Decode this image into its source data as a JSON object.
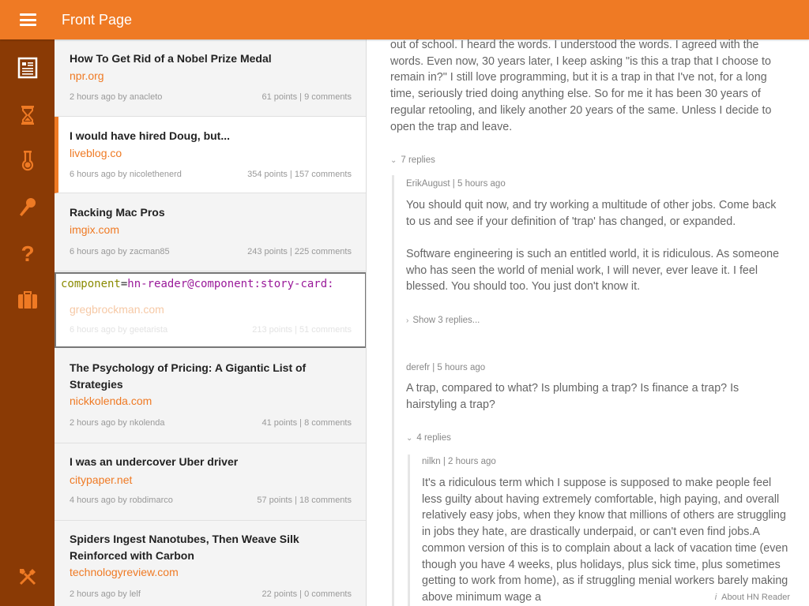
{
  "app": {
    "title": "Front Page",
    "about_label": "About HN Reader"
  },
  "sidebar": {
    "items": [
      {
        "name": "front-page",
        "icon": "newspaper-icon"
      },
      {
        "name": "newest",
        "icon": "hourglass-icon"
      },
      {
        "name": "show",
        "icon": "flask-icon"
      },
      {
        "name": "ask",
        "icon": "microphone-icon"
      },
      {
        "name": "help",
        "icon": "question-icon"
      },
      {
        "name": "jobs",
        "icon": "briefcase-icon"
      }
    ],
    "bottom_icon": "tools-icon"
  },
  "stories": [
    {
      "title": "How To Get Rid of a Nobel Prize Medal",
      "domain": "npr.org",
      "age": "2 hours ago by anacleto",
      "stats": "61 points | 9 comments"
    },
    {
      "title": "I would have hired Doug, but...",
      "domain": "liveblog.co",
      "age": "6 hours ago by nicolethenerd",
      "stats": "354 points | 157 comments"
    },
    {
      "title": "Racking Mac Pros",
      "domain": "imgix.com",
      "age": "6 hours ago by zacman85",
      "stats": "243 points | 225 comments"
    },
    {
      "title": "",
      "domain": "gregbrockman.com",
      "age": "6 hours ago by geetarista",
      "stats": "213 points | 51 comments"
    },
    {
      "title": "The Psychology of Pricing: A Gigantic List of Strategies",
      "domain": "nickkolenda.com",
      "age": "2 hours ago by nkolenda",
      "stats": "41 points | 8 comments"
    },
    {
      "title": "I was an undercover Uber driver",
      "domain": "citypaper.net",
      "age": "4 hours ago by robdimarco",
      "stats": "57 points | 18 comments"
    },
    {
      "title": "Spiders Ingest Nanotubes, Then Weave Silk Reinforced with Carbon",
      "domain": "technologyreview.com",
      "age": "2 hours ago by lelf",
      "stats": "22 points | 0 comments"
    }
  ],
  "debug_overlay": {
    "key": "component",
    "eq": "=",
    "value": "hn-reader@component:story-card:"
  },
  "comments": {
    "top_text": "out of school. I heard the words. I understood the words. I agreed with the words. Even now, 30 years later, I keep asking \"is this a trap that I choose to remain in?\" I still love programming, but it is a trap in that I've not, for a long time, seriously tried doing anything else.  So for me it has been 30 years of regular retooling, and likely another 20 years of the same. Unless I decide to open the trap and leave.",
    "top_replies_label": "7 replies",
    "reply1": {
      "author": "ErikAugust | 5 hours ago",
      "p1": "You should quit now, and try working a multitude of other jobs. Come back to us and see if your definition of 'trap' has changed, or expanded.",
      "p2": "Software engineering is such an entitled world, it is ridiculous. As someone who has seen the world of menial work, I will never, ever leave it. I feel blessed. You should too. You just don't know it.",
      "show_replies": "Show 3 replies..."
    },
    "reply2": {
      "author": "derefr | 5 hours ago",
      "text": "A trap, compared to what? Is plumbing a trap? Is finance a trap? Is hairstyling a trap?",
      "replies_label": "4 replies"
    },
    "reply3": {
      "author": "nilkn | 2 hours ago",
      "text": "It's a ridiculous term which I suppose is supposed to make people feel less guilty about having extremely comfortable, high paying, and overall relatively easy jobs, when they know that millions of others are struggling in jobs they hate, are drastically underpaid, or can't even find jobs.A common version of this is to complain about a lack of vacation time (even though you have 4 weeks, plus holidays, plus sick time, plus sometimes getting to work from home), as if struggling menial workers barely making above minimum wage a"
    }
  },
  "colors": {
    "accent": "#ef7a24",
    "sidebar": "#8a3a05"
  }
}
